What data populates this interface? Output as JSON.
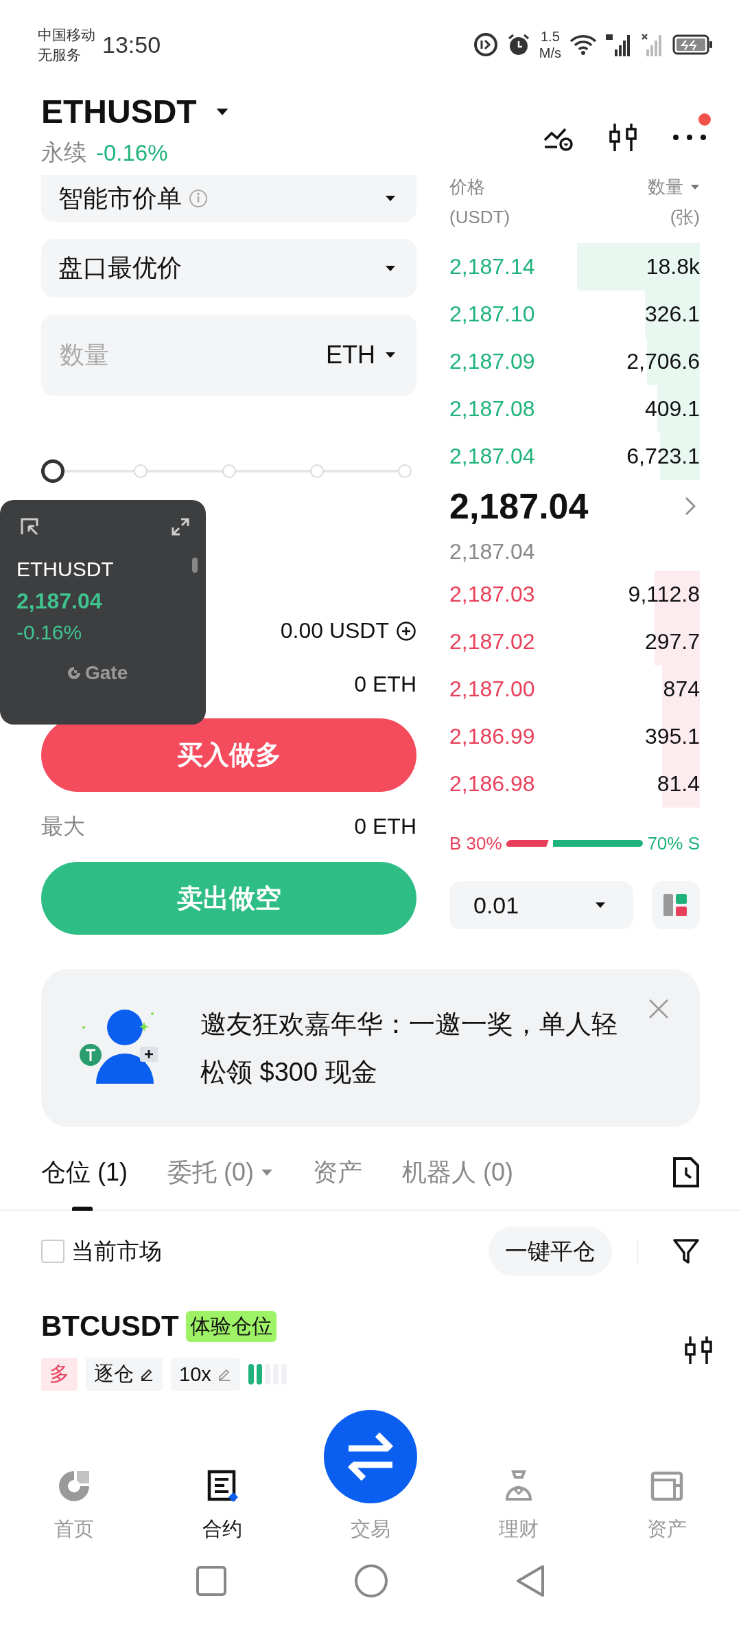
{
  "status_bar": {
    "carrier": "中国移动",
    "service": "无服务",
    "time": "13:50",
    "speed": "1.5",
    "speed_unit": "M/s"
  },
  "header": {
    "symbol": "ETHUSDT",
    "contract_type": "永续",
    "change": "-0.16%",
    "has_notification": true
  },
  "order_form": {
    "order_type": "智能市价单",
    "price_type": "盘口最优价",
    "quantity": {
      "placeholder": "数量",
      "unit": "ETH"
    },
    "slider": {
      "level": 0
    },
    "available_value": "0.00 USDT",
    "buy": {
      "max_value": "0 ETH",
      "button": "买入做多"
    },
    "sell": {
      "max_label": "最大",
      "max_value": "0 ETH",
      "button": "卖出做空"
    }
  },
  "floating_widget": {
    "symbol": "ETHUSDT",
    "price": "2,187.04",
    "change": "-0.16%",
    "brand": "Gate"
  },
  "order_book": {
    "price_header": "价格",
    "price_unit": "(USDT)",
    "qty_header": "数量",
    "qty_unit": "(张)",
    "asks": [
      {
        "price": "2,187.14",
        "qty": "18.8k"
      },
      {
        "price": "2,187.10",
        "qty": "326.1"
      },
      {
        "price": "2,187.09",
        "qty": "2,706.6"
      },
      {
        "price": "2,187.08",
        "qty": "409.1"
      },
      {
        "price": "2,187.04",
        "qty": "6,723.1"
      }
    ],
    "last_price": "2,187.04",
    "mark_price": "2,187.04",
    "bids": [
      {
        "price": "2,187.03",
        "qty": "9,112.8"
      },
      {
        "price": "2,187.02",
        "qty": "297.7"
      },
      {
        "price": "2,187.00",
        "qty": "874"
      },
      {
        "price": "2,186.99",
        "qty": "395.1"
      },
      {
        "price": "2,186.98",
        "qty": "81.4"
      }
    ],
    "ratio": {
      "buy_label": "B 30%",
      "sell_label": "70% S",
      "level": 0.3
    },
    "precision": "0.01"
  },
  "banner": {
    "text": "邀友狂欢嘉年华：一邀一奖，单人轻松领 $300 现金"
  },
  "tabs": [
    {
      "label": "仓位",
      "count": "(1)",
      "selected": true,
      "dropdown": false
    },
    {
      "label": "委托",
      "count": "(0)",
      "selected": false,
      "dropdown": true
    },
    {
      "label": "资产",
      "selected": false,
      "dropdown": false
    },
    {
      "label": "机器人",
      "count": "(0)",
      "selected": false,
      "dropdown": false
    }
  ],
  "filter": {
    "label": "当前市场",
    "checked": false,
    "close_all": "一键平仓"
  },
  "positions": [
    {
      "symbol": "BTCUSDT",
      "badge": "体验仓位",
      "side": "多",
      "margin_mode": "逐仓",
      "leverage": "10x",
      "level": 0.4
    }
  ],
  "bottom_nav": [
    {
      "label": "首页",
      "kind": "home",
      "selected": false
    },
    {
      "label": "合约",
      "kind": "futures",
      "selected": true
    },
    {
      "label": "交易",
      "kind": "trade",
      "selected": false
    },
    {
      "label": "理财",
      "kind": "earn",
      "selected": false
    },
    {
      "label": "资产",
      "kind": "assets",
      "selected": false
    }
  ]
}
